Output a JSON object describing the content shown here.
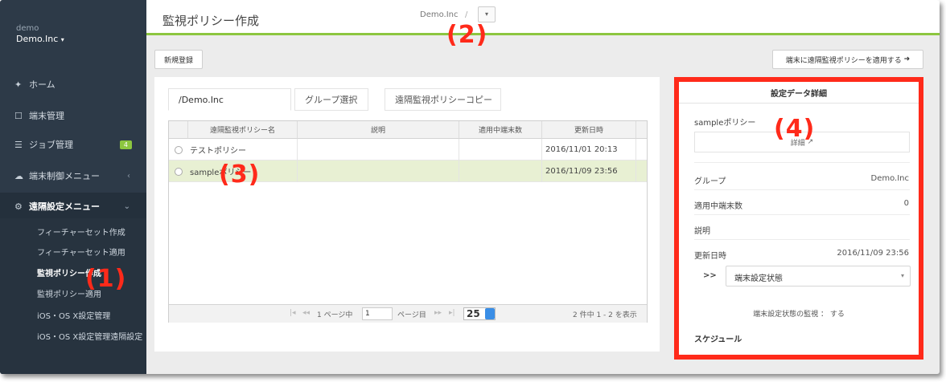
{
  "sidebar": {
    "org_sub": "demo",
    "org_main": "Demo.Inc",
    "org_caret": "▾",
    "items": [
      {
        "icon": "home-icon",
        "glyph": "✦",
        "label": "ホーム"
      },
      {
        "icon": "device-icon",
        "glyph": "☐",
        "label": "端末管理"
      },
      {
        "icon": "job-icon",
        "glyph": "☰",
        "label": "ジョブ管理",
        "badge": "4"
      },
      {
        "icon": "cloud-icon",
        "glyph": "☁",
        "label": "端末制御メニュー",
        "chevron": "‹"
      },
      {
        "icon": "gears-icon",
        "glyph": "⚙",
        "label": "遠隔設定メニュー",
        "chevron": "⌄"
      }
    ],
    "subitems": [
      "フィーチャーセット作成",
      "フィーチャーセット適用",
      "監視ポリシー作成",
      "監視ポリシー適用",
      "iOS・OS X設定管理",
      "iOS・OS X設定管理遠隔設定"
    ]
  },
  "header": {
    "title": "監視ポリシー作成",
    "breadcrumb": "Demo.Inc",
    "breadcrumb_sep": "/",
    "dropdown_caret": "▾"
  },
  "toolbar": {
    "new_label": "新規登録",
    "apply_label": "端末に遠隔監視ポリシーを適用する",
    "apply_arrow": "➜"
  },
  "tabs": [
    "/Demo.Inc",
    "グループ選択",
    "遠隔監視ポリシーコピー"
  ],
  "grid": {
    "columns": [
      "遠隔監視ポリシー名",
      "説明",
      "適用中端末数",
      "更新日時"
    ],
    "rows": [
      {
        "name": "テストポリシー",
        "desc": "",
        "count": "",
        "updated": "2016/11/01 20:13",
        "selected": false
      },
      {
        "name": "sampleポリシー",
        "desc": "",
        "count": "",
        "updated": "2016/11/09 23:56",
        "selected": true
      }
    ],
    "pager": {
      "first": "|◂",
      "prev": "◂◂",
      "page_prefix": "1 ページ中",
      "page_value": "1",
      "page_suffix": "ページ目",
      "next": "▸▸",
      "last": "▸|",
      "page_size": "25",
      "summary": "2 件中 1 - 2 を表示"
    }
  },
  "detail": {
    "title": "設定データ詳細",
    "policy_name": "sampleポリシー",
    "detail_link": "詳細",
    "group_label": "グループ",
    "group_value": "Demo.Inc",
    "count_label": "適用中端末数",
    "count_value": "0",
    "desc_label": "説明",
    "updated_label": "更新日時",
    "updated_value": "2016/11/09 23:56",
    "expand": ">>",
    "select_value": "端末設定状態",
    "select_caret": "▾",
    "monitor_text": "端末設定状態の監視 ： する",
    "schedule_label": "スケジュール"
  },
  "annotations": [
    "(1)",
    "(2)",
    "(3)",
    "(4)"
  ],
  "colors": {
    "accent": "#8cc63f",
    "annotation": "#ff2a1a",
    "sidebar": "#2d3a48"
  }
}
